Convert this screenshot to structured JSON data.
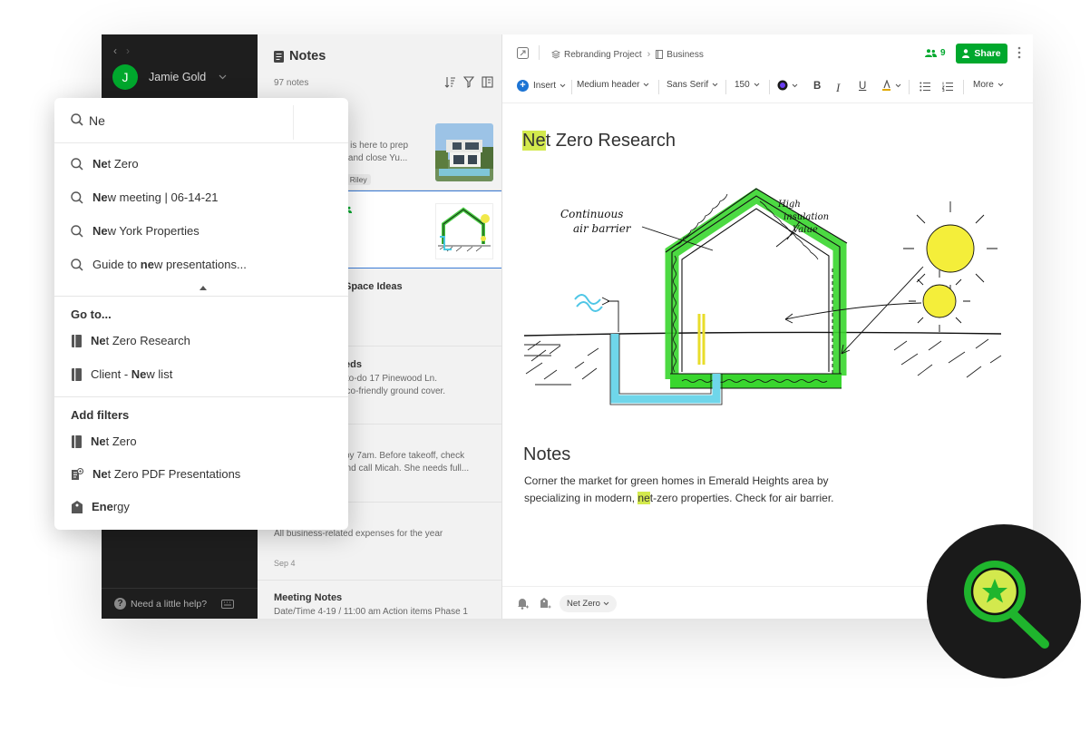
{
  "sidebar": {
    "user_initial": "J",
    "user_name": "Jamie Gold",
    "help_label": "Need a little help?"
  },
  "notes_list": {
    "title": "Notes",
    "count": "97 notes",
    "cards": [
      {
        "title": "",
        "snippet_1": "ing is here to prep",
        "snippet_2": "gh and close Yu...",
        "tags": [
          "min",
          "Riley"
        ]
      },
      {
        "title": "ch"
      },
      {
        "title": "Space Ideas"
      },
      {
        "title": "eds",
        "snippet_1": "ng to-do 17 Pinewood Ln.",
        "snippet_2": "eco-friendly ground cover."
      },
      {
        "snippet_1": "by 7am. Before takeoff, check",
        "snippet_2": "and call Micah. She needs full..."
      },
      {
        "snippet_1": "All business-related expenses for the year",
        "date": "Sep 4"
      },
      {
        "title": "Meeting Notes",
        "snippet_1": "Date/Time 4-19 / 11:00 am Action items Phase 1"
      }
    ]
  },
  "editor": {
    "breadcrumb": [
      "Rebranding Project",
      "Business"
    ],
    "share_count": "9",
    "share_label": "Share",
    "toolbar": {
      "insert": "Insert",
      "style": "Medium header",
      "font": "Sans Serif",
      "size": "150",
      "bold": "B",
      "italic": "I",
      "underline": "U",
      "more": "More"
    },
    "title_match": "Ne",
    "title_rest": "t Zero Research",
    "sketch_labels": {
      "air_barrier_1": "Continuous",
      "air_barrier_2": "air barrier",
      "insulation_1": "High",
      "insulation_2": "insulation",
      "insulation_3": "Value"
    },
    "section_heading": "Notes",
    "body_before": "Corner the market for green homes in Emerald Heights area by specializing in modern, ",
    "body_match": "ne",
    "body_after": "t-zero properties. Check for air barrier.",
    "footer_tag": "Net Zero"
  },
  "search": {
    "query": "Ne",
    "suggestions": [
      {
        "pre": "",
        "match": "Ne",
        "post": "t Zero"
      },
      {
        "pre": "",
        "match": "Ne",
        "post": "w meeting | 06-14-21"
      },
      {
        "pre": "",
        "match": "Ne",
        "post": "w York Properties"
      },
      {
        "pre": "Guide to ",
        "match": "ne",
        "post": "w presentations..."
      }
    ],
    "goto_heading": "Go to...",
    "goto": [
      {
        "pre": "",
        "match": "Ne",
        "post": "t Zero Research",
        "icon": "notebook-icon"
      },
      {
        "pre": "Client - ",
        "match": "Ne",
        "post": "w list",
        "icon": "notebook-icon"
      }
    ],
    "filters_heading": "Add filters",
    "filters": [
      {
        "pre": "",
        "match": "Ne",
        "post": "t Zero",
        "icon": "notebook-icon"
      },
      {
        "pre": "",
        "match": "Ne",
        "post": "t Zero PDF Presentations",
        "icon": "document-icon"
      },
      {
        "pre": "",
        "match": "Ene",
        "post": "rgy",
        "icon": "tag-icon"
      }
    ]
  },
  "colors": {
    "brand_green": "#00a82d",
    "highlight": "#d3e94d",
    "sidebar_bg": "#1e1e1e",
    "link_blue": "#1c74d4"
  }
}
